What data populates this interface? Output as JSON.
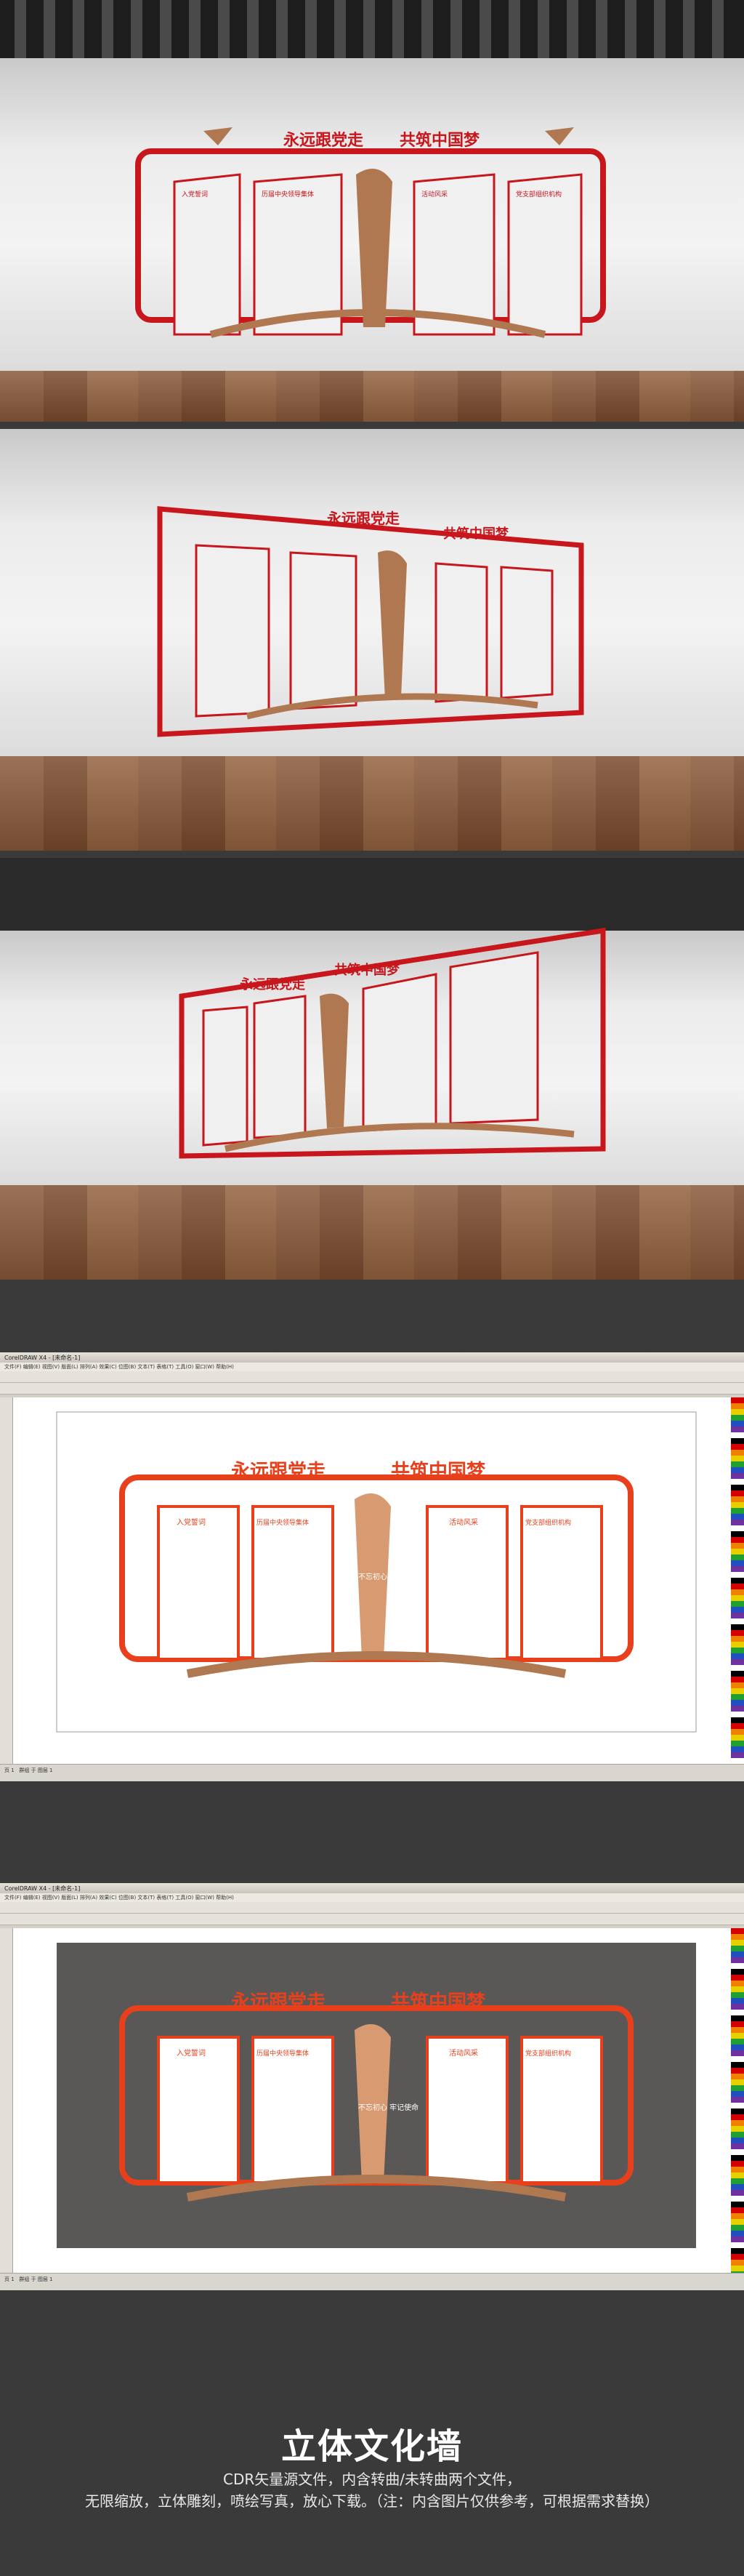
{
  "wall": {
    "slogan_left": "永远跟党走",
    "slogan_right": "共筑中国梦",
    "panel1_heading": "入党誓词",
    "panel2_heading": "历届中央领导集体",
    "pillar_text": "不忘初心 牢记使命",
    "panel3_heading": "活动风采",
    "panel4_heading": "党支部组织机构"
  },
  "software": {
    "title": "CorelDRAW X4 - [未命名-1]",
    "menu": "文件(F)  编辑(E)  视图(V)  版面(L)  排列(A)  效果(C)  位图(B)  文本(T)  表格(T)  工具(O)  窗口(W)  帮助(H)",
    "page_tab": "页 1",
    "status": "群组 于 图层 1"
  },
  "banner": {
    "title": "立体文化墙",
    "line1": "CDR矢量源文件，内含转曲/未转曲两个文件，",
    "line2": "无限缩放，立体雕刻，喷绘写真，放心下载。（注：内含图片仅供参考，可根据需求替换）"
  },
  "colors": {
    "red": "#c8161d",
    "orange_red": "#e8401c",
    "bronze": "#b07850",
    "dark_bg": "#3a3a3a",
    "dark_canvas": "#5a5856"
  }
}
